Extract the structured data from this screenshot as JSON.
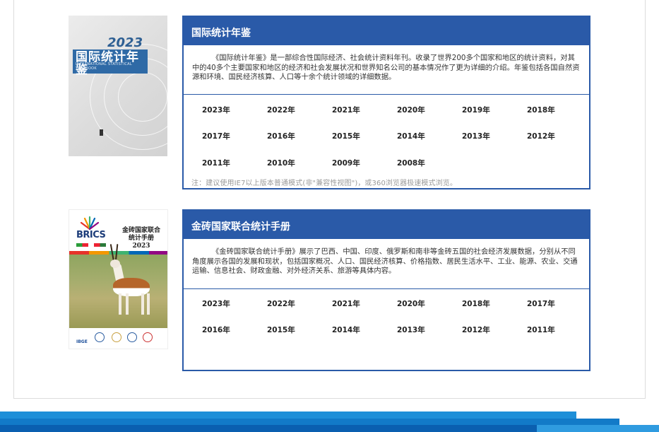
{
  "sections": [
    {
      "title": "国际统计年鉴",
      "description": "《国际统计年鉴》是一部综合性国际经济、社会统计资料年刊。收录了世界200多个国家和地区的统计资料，对其中的40多个主要国家和地区的经济和社会发展状况和世界知名公司的基本情况作了更为详细的介绍。年鉴包括各国自然资源和环境、国民经济核算、人口等十余个统计领域的详细数据。",
      "years": [
        "2023年",
        "2022年",
        "2021年",
        "2020年",
        "2019年",
        "2018年",
        "2017年",
        "2016年",
        "2015年",
        "2014年",
        "2013年",
        "2012年",
        "2011年",
        "2010年",
        "2009年",
        "2008年"
      ],
      "note": "注：建议使用IE7以上版本普通模式(非\"兼容性视图\")，或360浏览器极速模式浏览。",
      "cover": {
        "year": "2023",
        "title": "国际统计年鉴",
        "title_en": "INTERNATIONAL STATISTICAL YEARBOOK"
      }
    },
    {
      "title": "金砖国家联合统计手册",
      "description": "《金砖国家联合统计手册》展示了巴西、中国、印度、俄罗斯和南非等金砖五国的社会经济发展数据，分别从不同角度展示各国的发展和现状，包括国家概况、人口、国民经济核算、价格指数、居民生活水平、工业、能源、农业、交通运输、信息社会、财政金融、对外经济关系、旅游等具体内容。",
      "years": [
        "2023年",
        "2022年",
        "2021年",
        "2020年",
        "2018年",
        "2017年",
        "2016年",
        "2015年",
        "2014年",
        "2013年",
        "2012年",
        "2011年"
      ],
      "cover": {
        "brand": "BRICS",
        "title_line1": "金砖国家联合",
        "title_line2": "统计手册",
        "year": "2023",
        "agency": "IBGE"
      }
    }
  ],
  "colors": {
    "accent": "#2a5aa8",
    "note": "#9a9a9a",
    "footer_light": "#1e8fd8",
    "footer_dark": "#0a5fb0"
  }
}
